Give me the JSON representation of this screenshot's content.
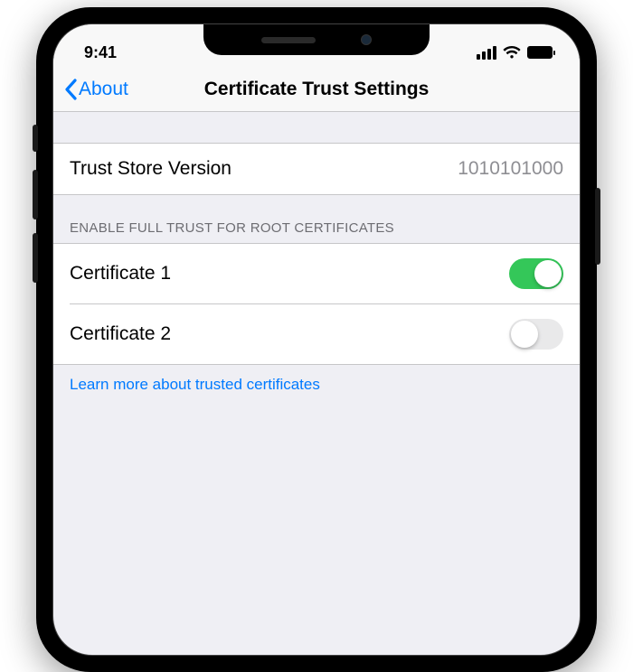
{
  "status": {
    "time": "9:41"
  },
  "nav": {
    "back_label": "About",
    "title": "Certificate Trust Settings"
  },
  "trust_store": {
    "label": "Trust Store Version",
    "value": "1010101000"
  },
  "section_header": "ENABLE FULL TRUST FOR ROOT CERTIFICATES",
  "certificates": [
    {
      "name": "Certificate 1",
      "enabled": true
    },
    {
      "name": "Certificate 2",
      "enabled": false
    }
  ],
  "footer_link": "Learn more about trusted certificates",
  "colors": {
    "accent": "#007aff",
    "switch_on": "#34c759"
  }
}
